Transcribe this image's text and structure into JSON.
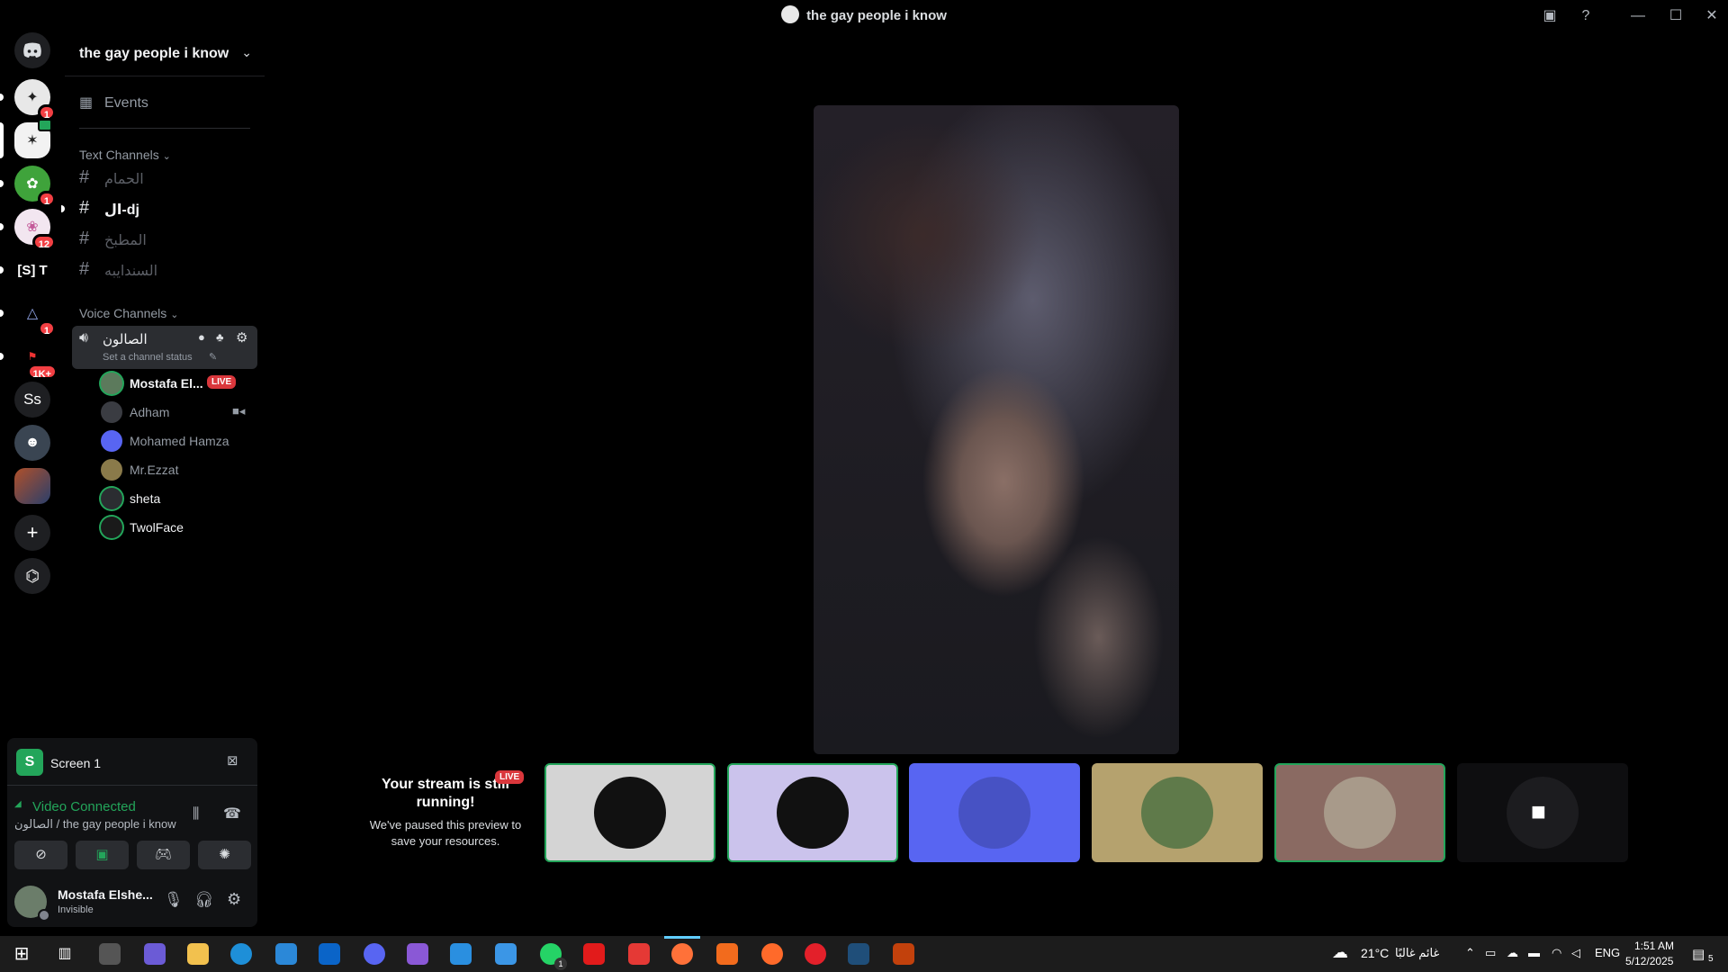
{
  "window": {
    "title": "the gay people i know",
    "controls": {
      "minimize": "—",
      "maximize": "☐",
      "close": "✕"
    }
  },
  "rail": {
    "servers": [
      {
        "icon": "discord-home-icon",
        "badge": ""
      },
      {
        "icon": "server-icon",
        "badge": "1"
      },
      {
        "icon": "server-icon",
        "badge": ""
      },
      {
        "icon": "server-icon",
        "badge": "1"
      },
      {
        "icon": "server-icon",
        "badge": "12"
      },
      {
        "icon": "server-icon",
        "label": "[S] T"
      },
      {
        "icon": "server-icon",
        "badge": "1"
      },
      {
        "icon": "server-icon",
        "badge": "1K+"
      },
      {
        "icon": "server-icon",
        "label": "Ss"
      },
      {
        "icon": "server-icon",
        "badge": ""
      },
      {
        "icon": "server-icon",
        "badge": ""
      }
    ],
    "add_server": "+",
    "discover": "⌬"
  },
  "sidebar": {
    "guild_name": "the gay people i know",
    "events": "Events",
    "text_category": "Text Channels",
    "text_channels": [
      "الحمام",
      "ال-dj",
      "المطبخ",
      "السندايبه"
    ],
    "voice_category": "Voice Channels",
    "voice_channel": {
      "name": "الصالون",
      "status_hint": "Set a channel status"
    },
    "voice_users": [
      {
        "name": "Mostafa El...",
        "tag": "LIVE"
      },
      {
        "name": "Adham",
        "tag": "video"
      },
      {
        "name": "Mohamed Hamza"
      },
      {
        "name": "Mr.Ezzat"
      },
      {
        "name": "sheta"
      },
      {
        "name": "TwolFace"
      }
    ]
  },
  "rtc": {
    "screen_label": "Screen 1",
    "status": "Video Connected",
    "location": "الصالون / the gay people i know"
  },
  "user": {
    "name": "Mostafa Elshe...",
    "status": "Invisible"
  },
  "stage": {
    "stream_title": "Your stream is still running!",
    "stream_live": "LIVE",
    "stream_body": "We've paused this preview to save your resources."
  },
  "taskbar": {
    "weather": "21°C",
    "weather_text": "غائم غالبًا",
    "language": "ENG",
    "time": "1:51 AM",
    "date": "5/12/2025",
    "notifications": "5",
    "whatsapp_badge": "1"
  },
  "colors": {
    "accent_green": "#23a55a",
    "live_red": "#da373c",
    "tile_blue": "#5865f2",
    "tile_lavender": "#cbc3ec",
    "tile_gold": "#b5a26e",
    "tile_rose": "#8a6a62"
  }
}
